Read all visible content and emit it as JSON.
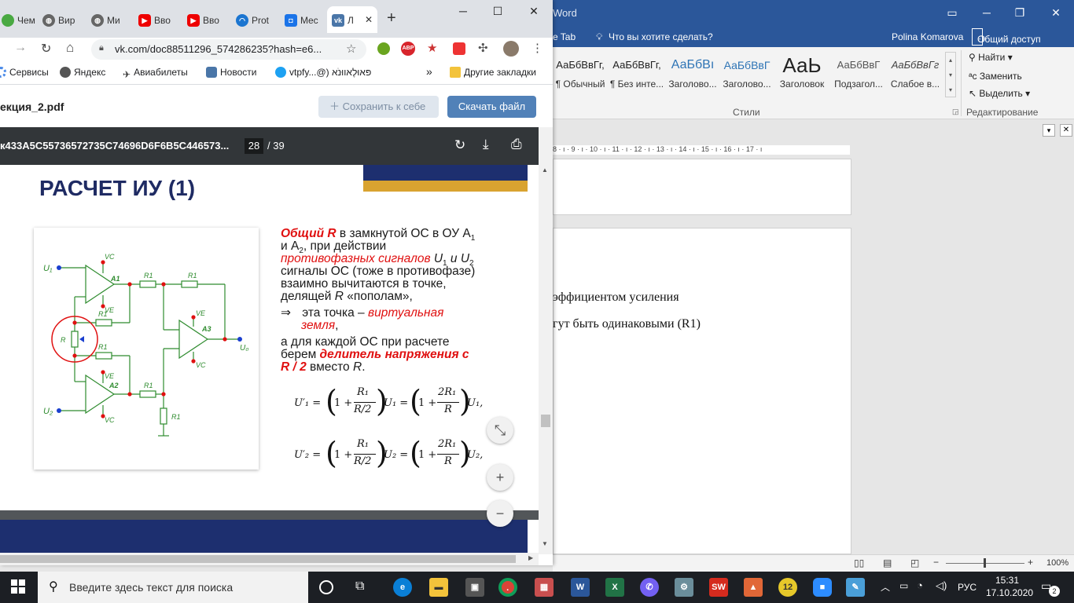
{
  "word": {
    "title": "Word",
    "tellme": "Что вы хотите сделать?",
    "tab_fragment": "e Tab",
    "user": "Polina Komarova",
    "share": "Общий доступ",
    "styles": [
      {
        "sample": "АаБбВвГг,",
        "label": "¶ Обычный"
      },
      {
        "sample": "АаБбВвГг,",
        "label": "¶ Без инте..."
      },
      {
        "sample": "АаБбВı",
        "label": "Заголово..."
      },
      {
        "sample": "АаБбВвГ",
        "label": "Заголово..."
      },
      {
        "sample": "АаЬ",
        "label": "Заголовок"
      },
      {
        "sample": "АаБбВвГ",
        "label": "Подзагол..."
      },
      {
        "sample": "АаБбВвГг",
        "label": "Слабое в..."
      }
    ],
    "styles_group": "Стили",
    "editing_group": "Редактирование",
    "find": "Найти",
    "replace": "Заменить",
    "select": "Выделить",
    "ruler": "8 · ı · 9 · ı · 10 · ı · 11 · ı · 12 · ı · 13 · ı · 14 · ı · 15 · ı · 16 · ı · 17 · ı",
    "doc_line1": "эффициентом усиления",
    "doc_line2": "гут быть одинаковыми (R1)",
    "zoom": "100%"
  },
  "chrome": {
    "tabs": [
      "Чем",
      "Вир",
      "Ми",
      "Вво",
      "Вво",
      "Prot",
      "Mec",
      "Л"
    ],
    "url": "vk.com/doc88511296_574286235?hash=e6...",
    "bookmarks": [
      "Сервисы",
      "Яндекс",
      "Авиабилеты",
      "Новости",
      "vtpfy...@) פּאוּלֶאווּנֹא"
    ],
    "other_bookmarks": "Другие закладки",
    "more": "»",
    "doc_name": "екция_2.pdf",
    "save_btn": "Сохранить к себе",
    "download_btn": "Скачать файл"
  },
  "pdf": {
    "file": "к433A5C55736572735C74696D6F6B5C446573...",
    "page": "28",
    "total": "/ 39",
    "title": "РАСЧЕТ ИУ (1)",
    "t_general_r": "Общий R",
    "t1": " в замкнутой ОС в ОУ А",
    "t1_sub": "1",
    "t2a": "и А",
    "t2_sub": "2",
    "t2b": ", при действии",
    "t3_red": "противофазных сигналов",
    "t3": " U",
    "t3_sub1": "1",
    "t3_and": " и U",
    "t3_sub2": "2",
    "t4": "сигналы ОС (тоже в противофазе)",
    "t5": "взаимно вычитаются в точке,",
    "t6a": "делящей ",
    "t6_r": "R",
    "t6b": " «пополам»,",
    "t7_arrow": "⇒",
    "t7a": " эта точка – ",
    "t7_red": "виртуальная",
    "t8_red": "земля",
    "t8": ",",
    "t9": "а для каждой ОС при расчете",
    "t10a": "берем ",
    "t10_red": "делитель напряжения с",
    "t11_red": "R / 2",
    "t11a": " вместо ",
    "t11_r": "R",
    "t11b": ".",
    "f1_lhs": "U′₁ =",
    "f1_a": "1 +",
    "f1_num": "R₁",
    "f1_den": "R/2",
    "f1_mid": "U₁ =",
    "f1_b": "1 +",
    "f1_num2": "2R₁",
    "f1_den2": "R",
    "f1_end": "U₁,",
    "f2_lhs": "U′₂ =",
    "f2_a": "1 +",
    "f2_num": "R₁",
    "f2_den": "R/2",
    "f2_mid": "U₂ =",
    "f2_b": "1 +",
    "f2_num2": "2R₁",
    "f2_den2": "R",
    "f2_end": "U₂,",
    "circuit": {
      "u1": "U₁",
      "u2": "U₂",
      "u0": "U₀",
      "a1": "A1",
      "a2": "A2",
      "a3": "A3",
      "vc": "VC",
      "ve": "VE",
      "r": "R",
      "r1": "R1"
    }
  },
  "taskbar": {
    "search": "Введите здесь текст для поиска",
    "lang": "РУС",
    "time": "15:31",
    "date": "17.10.2020",
    "notif": "2"
  }
}
